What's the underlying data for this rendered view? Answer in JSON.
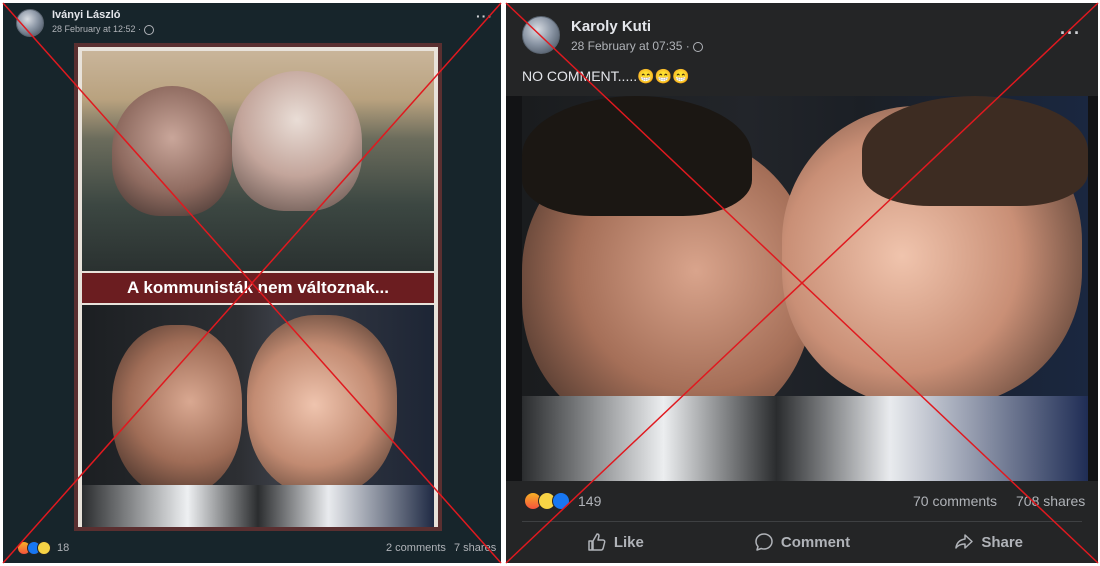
{
  "left_post": {
    "author": "Iványi László",
    "timestamp": "28 February at 12:52 ·",
    "caption": "A kommunisták nem változnak...",
    "reaction_count": "18",
    "comments": "2 comments",
    "shares": "7 shares",
    "more_icon": "more-options-icon"
  },
  "right_post": {
    "author": "Karoly Kuti",
    "timestamp": "28 February at 07:35 ·",
    "text": "NO COMMENT.....😁😁😁",
    "reaction_count": "149",
    "comments": "70 comments",
    "shares": "708 shares",
    "actions": {
      "like": "Like",
      "comment": "Comment",
      "share": "Share"
    }
  },
  "colors": {
    "cross": "#e0191f",
    "left_bg": "#17252b",
    "right_bg": "#242526"
  }
}
